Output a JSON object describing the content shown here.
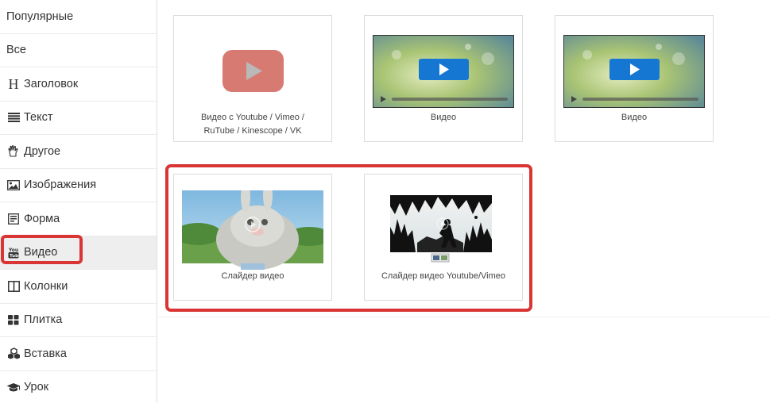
{
  "sidebar": {
    "items": [
      {
        "label": "Популярные",
        "icon": "none"
      },
      {
        "label": "Все",
        "icon": "none"
      },
      {
        "label": "Заголовок",
        "icon": "heading-icon"
      },
      {
        "label": "Текст",
        "icon": "text-lines-icon"
      },
      {
        "label": "Другое",
        "icon": "hand-icon"
      },
      {
        "label": "Изображения",
        "icon": "image-icon"
      },
      {
        "label": "Форма",
        "icon": "form-icon"
      },
      {
        "label": "Видео",
        "icon": "youtube-icon",
        "active": true
      },
      {
        "label": "Колонки",
        "icon": "columns-icon"
      },
      {
        "label": "Плитка",
        "icon": "grid-tiles-icon"
      },
      {
        "label": "Вставка",
        "icon": "cubes-icon"
      },
      {
        "label": "Урок",
        "icon": "graduation-cap-icon"
      }
    ],
    "heading_glyph": "H"
  },
  "blocks": {
    "youtube_vimeo": {
      "caption_line1": "Видео с Youtube / Vimeo /",
      "caption_line2": "RuTube / Kinescope / VK"
    },
    "video_1": {
      "caption": "Видео"
    },
    "video_2": {
      "caption": "Видео"
    },
    "slider_video": {
      "caption": "Слайдер видео"
    },
    "slider_youtube": {
      "caption": "Слайдер видео Youtube/Vimeo"
    }
  },
  "colors": {
    "highlight": "#d93535",
    "youtube_red": "#d77a72",
    "play_blue": "#1677d2"
  }
}
